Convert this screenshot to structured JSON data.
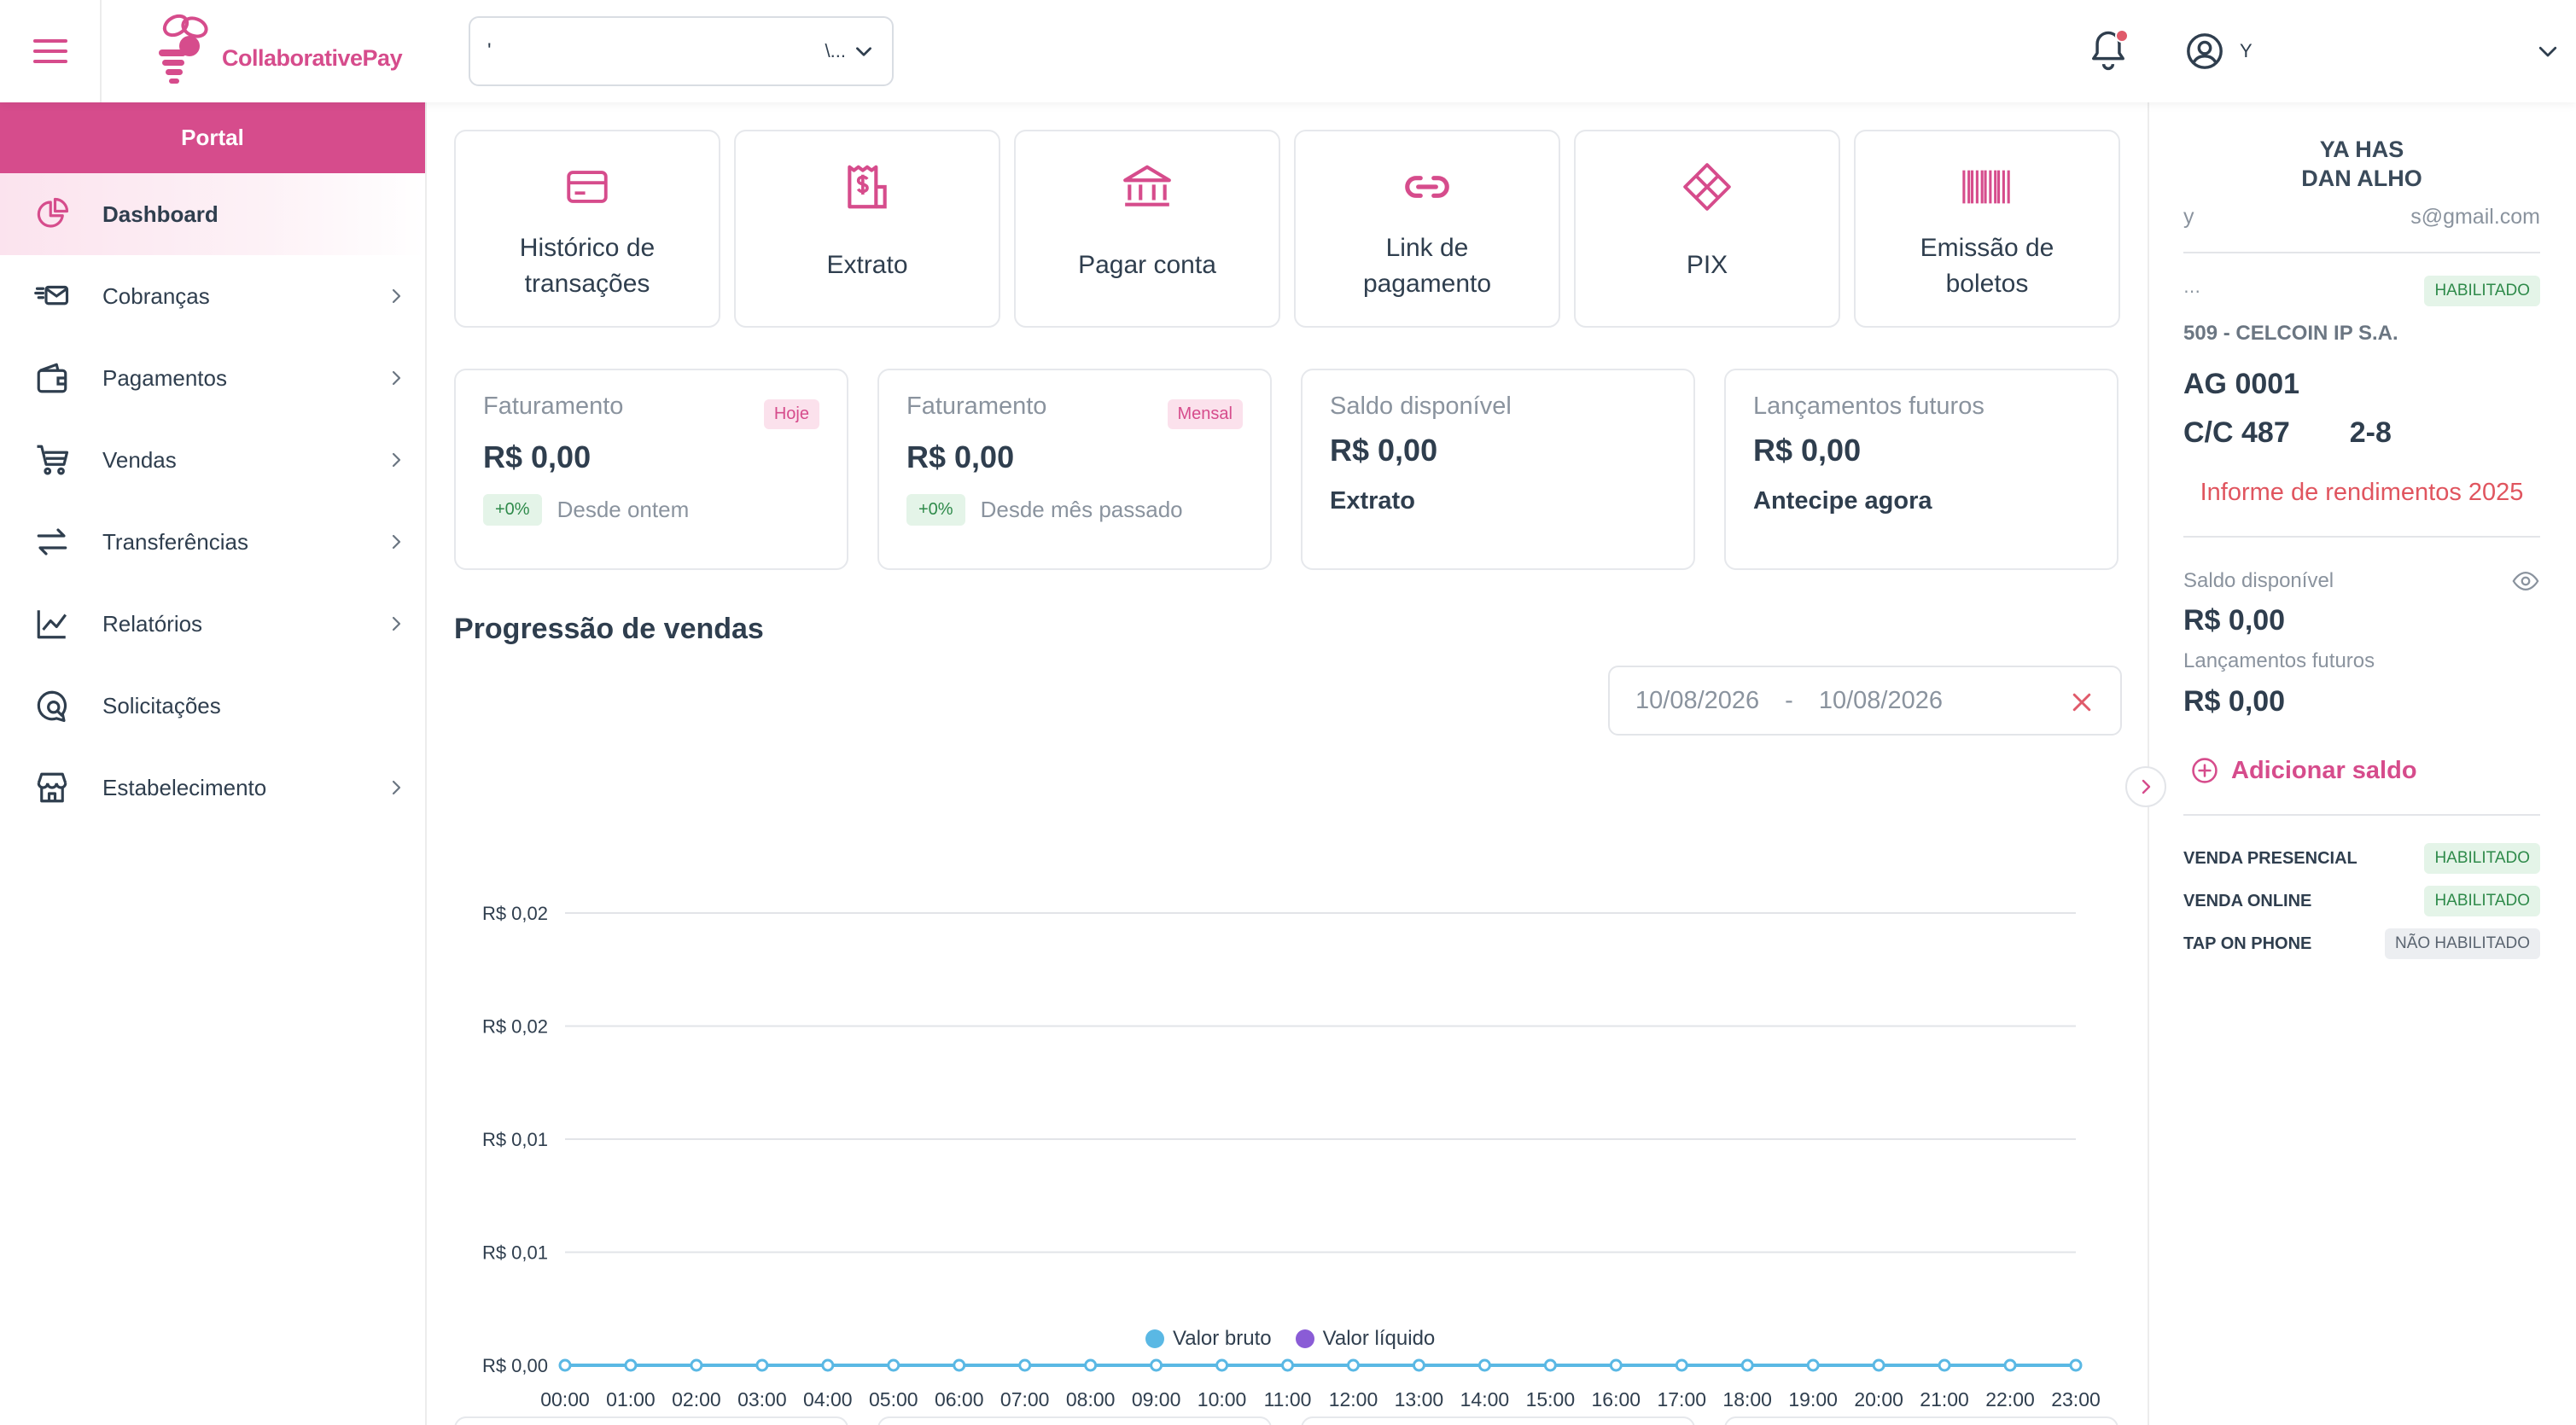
{
  "header": {
    "brand": "CollaborativePay",
    "selector_value": "'",
    "selector_ellipsis": "\\...",
    "user_name": "Y"
  },
  "sidebar": {
    "portal_label": "Portal",
    "items": [
      {
        "label": "Dashboard",
        "icon": "dashboard-pie-icon",
        "active": true,
        "chevron": false
      },
      {
        "label": "Cobranças",
        "icon": "mail-send-icon",
        "chevron": true
      },
      {
        "label": "Pagamentos",
        "icon": "wallet-icon",
        "chevron": true
      },
      {
        "label": "Vendas",
        "icon": "cart-icon",
        "chevron": true
      },
      {
        "label": "Transferências",
        "icon": "arrows-transfer-icon",
        "chevron": true
      },
      {
        "label": "Relatórios",
        "icon": "line-chart-icon",
        "chevron": true
      },
      {
        "label": "Solicitações",
        "icon": "chat-search-icon",
        "chevron": false
      },
      {
        "label": "Estabelecimento",
        "icon": "store-icon",
        "chevron": true
      }
    ]
  },
  "quick_actions": [
    {
      "label": "Histórico de\ntransações",
      "icon": "card-icon"
    },
    {
      "label": "Extrato",
      "icon": "receipt-dollar-icon"
    },
    {
      "label": "Pagar conta",
      "icon": "bank-icon"
    },
    {
      "label": "Link de\npagamento",
      "icon": "link-icon"
    },
    {
      "label": "PIX",
      "icon": "pix-icon"
    },
    {
      "label": "Emissão de\nboletos",
      "icon": "barcode-icon"
    }
  ],
  "stats": {
    "fat_hoje": {
      "title": "Faturamento",
      "badge": "Hoje",
      "value": "R$ 0,00",
      "pct": "+0%",
      "since": "Desde ontem"
    },
    "fat_mensal": {
      "title": "Faturamento",
      "badge": "Mensal",
      "value": "R$ 0,00",
      "pct": "+0%",
      "since": "Desde mês passado"
    },
    "saldo": {
      "title": "Saldo disponível",
      "value": "R$ 0,00",
      "link": "Extrato"
    },
    "lancamentos": {
      "title": "Lançamentos futuros",
      "value": "R$ 0,00",
      "link": "Antecipe agora"
    }
  },
  "sales": {
    "title": "Progressão de vendas",
    "date_start": "10/08/2026",
    "date_sep": "-",
    "date_end": "10/08/2026"
  },
  "chart_data": {
    "type": "line",
    "x": [
      "00:00",
      "01:00",
      "02:00",
      "03:00",
      "04:00",
      "05:00",
      "06:00",
      "07:00",
      "08:00",
      "09:00",
      "10:00",
      "11:00",
      "12:00",
      "13:00",
      "14:00",
      "15:00",
      "16:00",
      "17:00",
      "18:00",
      "19:00",
      "20:00",
      "21:00",
      "22:00",
      "23:00"
    ],
    "y_ticks": [
      "R$ 0,02",
      "R$ 0,02",
      "R$ 0,01",
      "R$ 0,01",
      "R$ 0,00"
    ],
    "ylim": [
      0,
      0.02
    ],
    "grid": true,
    "legend_position": "bottom-center",
    "series": [
      {
        "name": "Valor bruto",
        "color": "#5ab8e4",
        "values": [
          0,
          0,
          0,
          0,
          0,
          0,
          0,
          0,
          0,
          0,
          0,
          0,
          0,
          0,
          0,
          0,
          0,
          0,
          0,
          0,
          0,
          0,
          0,
          0
        ]
      },
      {
        "name": "Valor líquido",
        "color": "#8a5cd6",
        "values": [
          0,
          0,
          0,
          0,
          0,
          0,
          0,
          0,
          0,
          0,
          0,
          0,
          0,
          0,
          0,
          0,
          0,
          0,
          0,
          0,
          0,
          0,
          0,
          0
        ]
      }
    ]
  },
  "right_panel": {
    "name_line1": "YA           HAS",
    "name_line2": "DAN          ALHO",
    "email_prefix": "y",
    "email_suffix": "s@gmail.com",
    "account_status": "HABILITADO",
    "bank": "509 - CELCOIN IP S.A.",
    "agency": "AG 0001",
    "account_start": "C/C 487",
    "account_end": "2-8",
    "income_report": "Informe de rendimentos 2025",
    "saldo_label": "Saldo disponível",
    "saldo_value": "R$ 0,00",
    "lanc_label": "Lançamentos futuros",
    "lanc_value": "R$ 0,00",
    "add_balance": "Adicionar saldo",
    "features": [
      {
        "label": "VENDA PRESENCIAL",
        "status": "HABILITADO",
        "enabled": true
      },
      {
        "label": "VENDA ONLINE",
        "status": "HABILITADO",
        "enabled": true
      },
      {
        "label": "TAP ON PHONE",
        "status": "NÃO HABILITADO",
        "enabled": false
      }
    ]
  },
  "colors": {
    "brand": "#d64c8c",
    "text": "#2f3e4e",
    "muted": "#8a939e",
    "success": "#2e8a4a",
    "danger": "#e0555f",
    "series_bruto": "#5ab8e4",
    "series_liquido": "#8a5cd6"
  }
}
